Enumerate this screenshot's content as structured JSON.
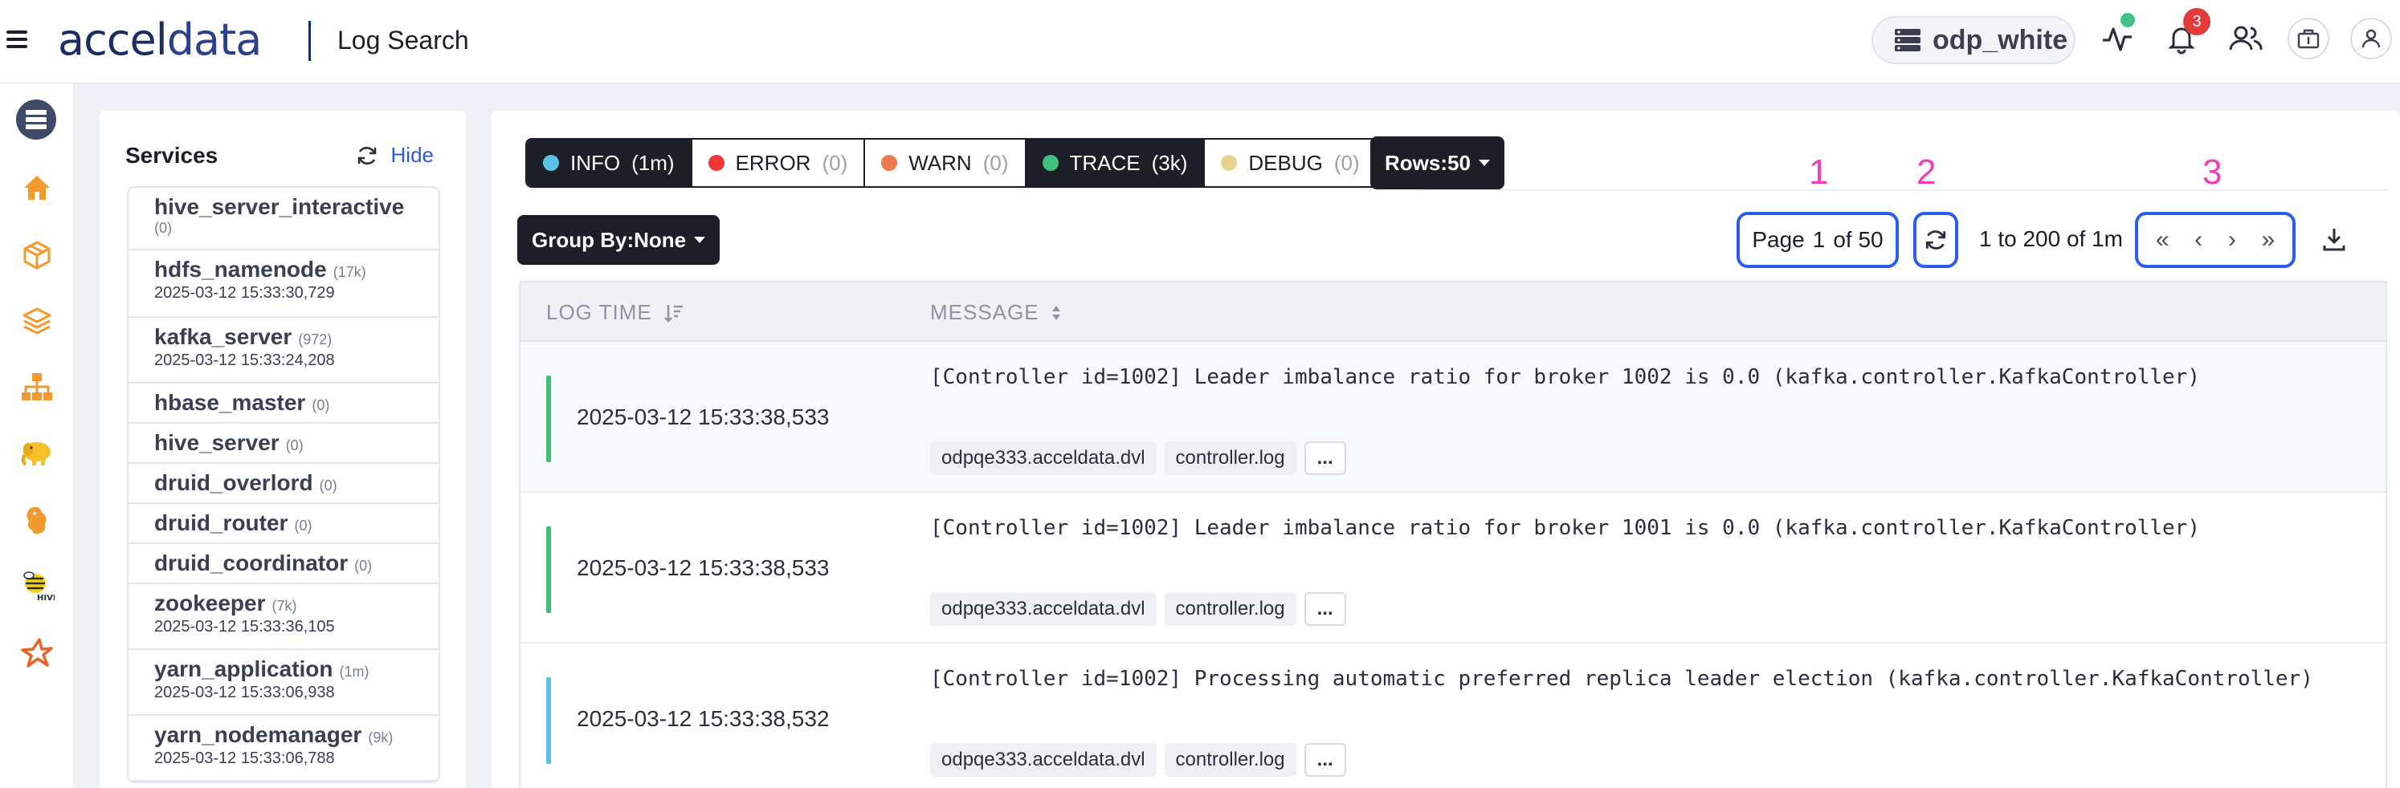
{
  "header": {
    "logo_text_prefix": "accel",
    "logo_text_suffix": "data",
    "app_title": "Log Search",
    "cluster_name": "odp_white",
    "notification_count": "3",
    "icons": [
      "menu-icon",
      "database-icon",
      "activity-icon",
      "bell-icon",
      "users-icon",
      "briefcase-icon",
      "user-icon"
    ]
  },
  "rail": {
    "items": [
      "database-icon",
      "home-icon",
      "package-icon",
      "layers-icon",
      "hierarchy-icon",
      "hadoop-elephant-icon",
      "hive-icon",
      "hive-bee-icon",
      "spark-star-icon"
    ]
  },
  "services": {
    "title": "Services",
    "hide_label": "Hide",
    "items": [
      {
        "name": "hive_server_interactive",
        "count": "(0)",
        "timestamp": ""
      },
      {
        "name": "hdfs_namenode",
        "count": "(17k)",
        "timestamp": "2025-03-12 15:33:30,729"
      },
      {
        "name": "kafka_server",
        "count": "(972)",
        "timestamp": "2025-03-12 15:33:24,208"
      },
      {
        "name": "hbase_master",
        "count": "(0)",
        "timestamp": ""
      },
      {
        "name": "hive_server",
        "count": "(0)",
        "timestamp": ""
      },
      {
        "name": "druid_overlord",
        "count": "(0)",
        "timestamp": ""
      },
      {
        "name": "druid_router",
        "count": "(0)",
        "timestamp": ""
      },
      {
        "name": "druid_coordinator",
        "count": "(0)",
        "timestamp": ""
      },
      {
        "name": "zookeeper",
        "count": "(7k)",
        "timestamp": "2025-03-12 15:33:36,105"
      },
      {
        "name": "yarn_application",
        "count": "(1m)",
        "timestamp": "2025-03-12 15:33:06,938"
      },
      {
        "name": "yarn_nodemanager",
        "count": "(9k)",
        "timestamp": "2025-03-12 15:33:06,788"
      }
    ]
  },
  "levels": [
    {
      "label": "INFO",
      "count": "(1m)",
      "color": "#5bc0e6",
      "active": true
    },
    {
      "label": "ERROR",
      "count": "(0)",
      "color": "#ee3636",
      "active": false
    },
    {
      "label": "WARN",
      "count": "(0)",
      "color": "#ef7a50",
      "active": false
    },
    {
      "label": "TRACE",
      "count": "(3k)",
      "color": "#41c07d",
      "active": true
    },
    {
      "label": "DEBUG",
      "count": "(0)",
      "color": "#e8d38e",
      "active": false
    }
  ],
  "toolbar": {
    "rows_label": "Rows:50",
    "group_by_label": "Group By:None",
    "page_prefix": "Page",
    "page_current": "1",
    "page_total": "of 50",
    "range_text": "1 to 200 of 1m",
    "nav_first": "«",
    "nav_prev": "‹",
    "nav_next": "›",
    "nav_last": "»"
  },
  "annotations": {
    "a1": "1",
    "a2": "2",
    "a3": "3",
    "color": "#ee3fb8"
  },
  "table": {
    "columns": {
      "log_time": "LOG TIME",
      "message": "MESSAGE"
    },
    "rows": [
      {
        "time": "2025-03-12 15:33:38,533",
        "level_color": "#41c07d",
        "message": "[Controller id=1002] Leader imbalance ratio for broker 1002 is 0.0 (kafka.controller.KafkaController)",
        "host": "odpqe333.acceldata.dvl",
        "file": "controller.log",
        "more": "..."
      },
      {
        "time": "2025-03-12 15:33:38,533",
        "level_color": "#41c07d",
        "message": "[Controller id=1002] Leader imbalance ratio for broker 1001 is 0.0 (kafka.controller.KafkaController)",
        "host": "odpqe333.acceldata.dvl",
        "file": "controller.log",
        "more": "..."
      },
      {
        "time": "2025-03-12 15:33:38,532",
        "level_color": "#5bc0e6",
        "message": "[Controller id=1002] Processing automatic preferred replica leader election (kafka.controller.KafkaController)",
        "host": "odpqe333.acceldata.dvl",
        "file": "controller.log",
        "more": "..."
      }
    ]
  }
}
